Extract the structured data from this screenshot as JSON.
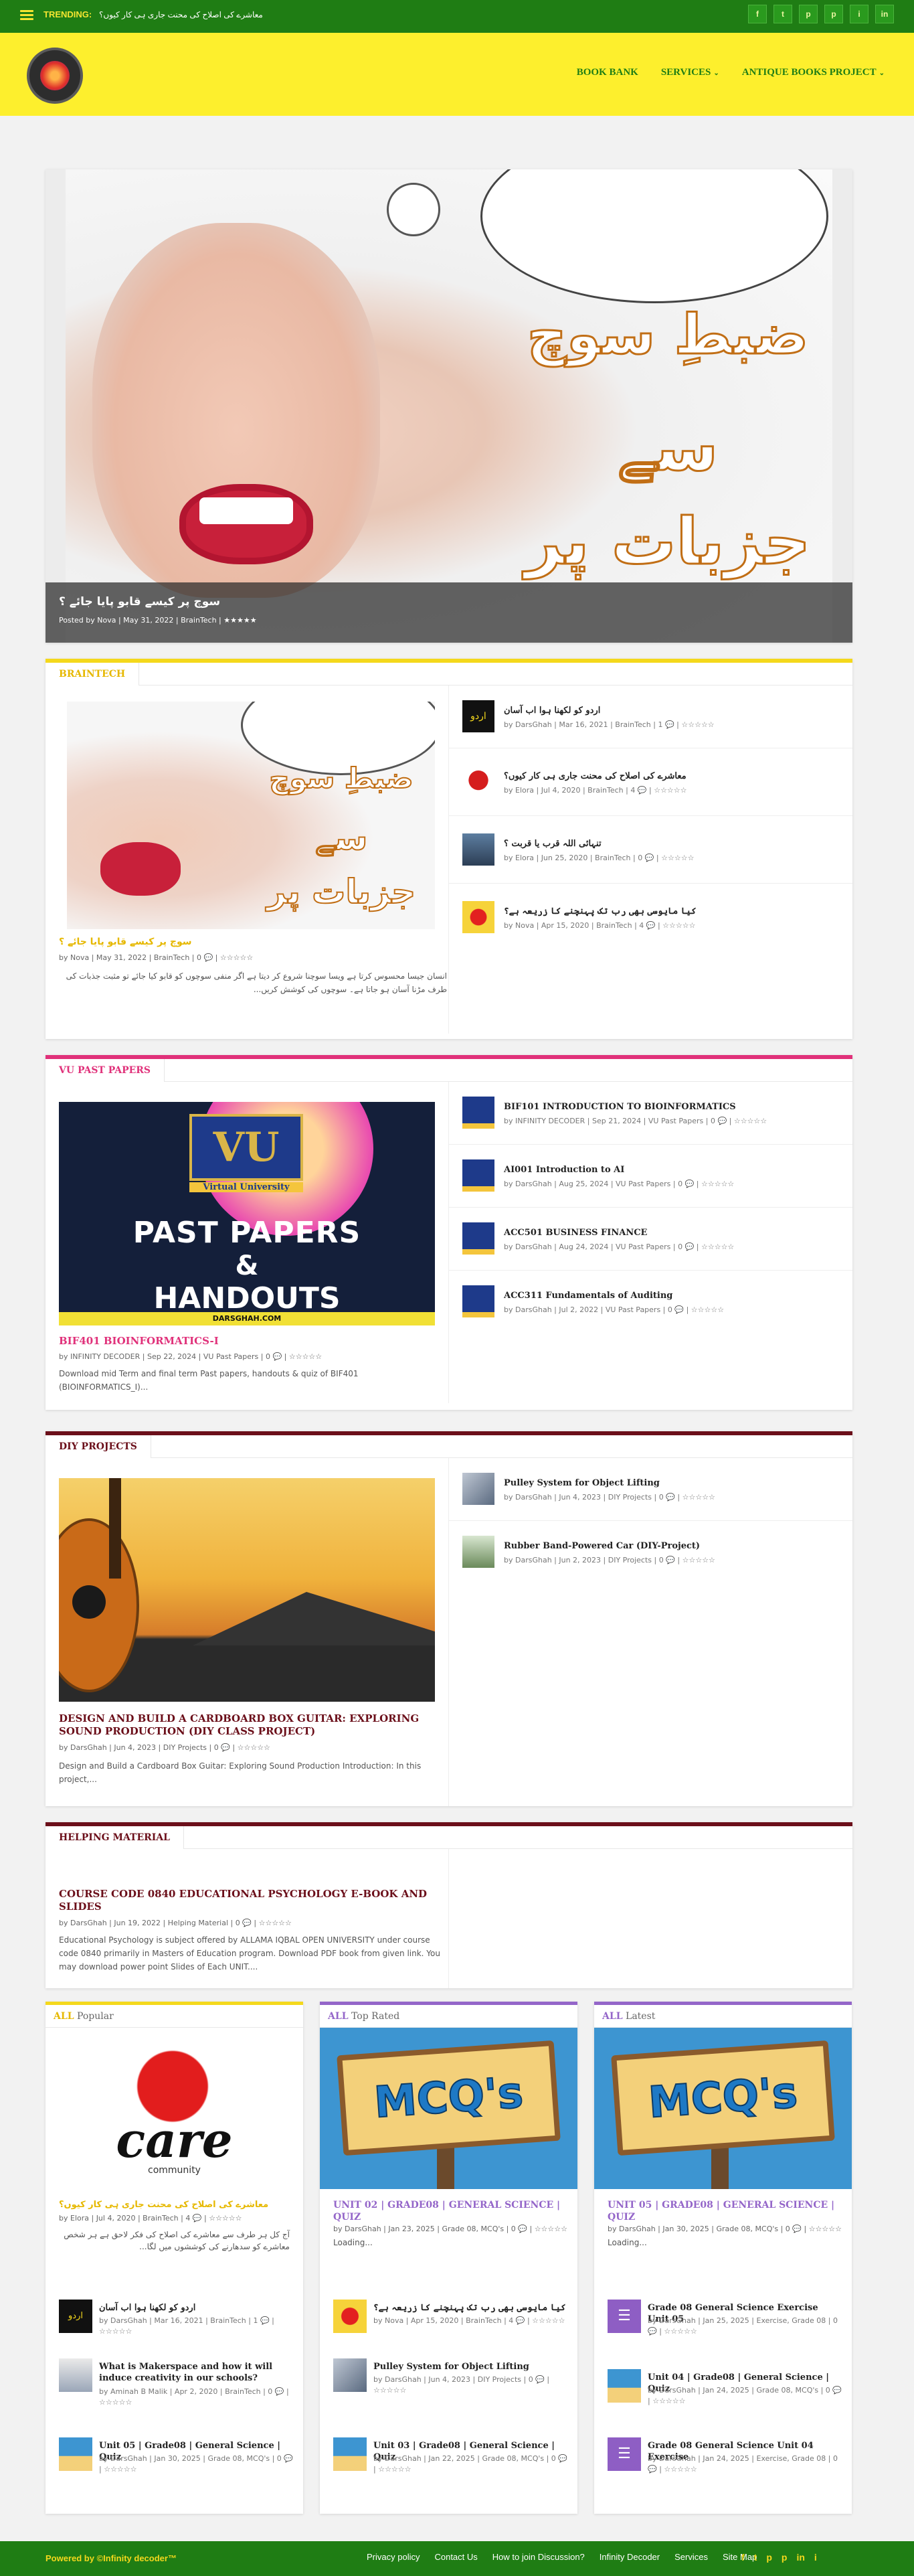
{
  "topbar": {
    "trending_label": "TRENDING:",
    "trending_text": "معاشرے کی اصلاح کی محنت جاری ہی کار کیوں؟",
    "social": [
      "f",
      "t",
      "p",
      "p",
      "i",
      "in"
    ]
  },
  "nav": {
    "items": [
      "BOOK BANK",
      "SERVICES",
      "ANTIQUE BOOKS PROJECT"
    ]
  },
  "hero": {
    "title": "سوچ پر کیسے قابو پایا جائے ؟",
    "meta": "Posted by Nova | May 31, 2022 | BrainTech | ★★★★★",
    "image_text_1": "ضبطِ سوچ",
    "image_text_2": "سے",
    "image_text_3": "جزبات پر"
  },
  "braintech": {
    "heading": "BRAINTECH",
    "main_title": "سوچ پر کیسے قابو پایا جائے ؟",
    "main_meta": "by Nova | May 31, 2022 | BrainTech | 0 💬 | ☆☆☆☆☆",
    "excerpt": "انسان جیسا محسوس کرتا ہے ویسا سوچنا شروع کر دیتا ہے اگر منفی سوچوں کو قابو کیا جائے تو مثبت جذبات کی طرف مڑنا آسان ہو جاتا ہے۔ سوچوں کی کوشش کریں...",
    "items": [
      {
        "title": "اردو کو لکھنا ہوا اب آسان",
        "meta": "by DarsGhah | Mar 16, 2021 | BrainTech | 1 💬 | ☆☆☆☆☆"
      },
      {
        "title": "معاشرے کی اصلاح کی محنت جاری ہی کار کیوں؟",
        "meta": "by Elora | Jul 4, 2020 | BrainTech | 4 💬 | ☆☆☆☆☆"
      },
      {
        "title": "تنہائی اللہ قرب یا قربت ؟",
        "meta": "by Elora | Jun 25, 2020 | BrainTech | 0 💬 | ☆☆☆☆☆"
      },
      {
        "title": "کیا مایوسی بھی رب تک پہنچنے کا زریعہ ہے؟",
        "meta": "by Nova | Apr 15, 2020 | BrainTech | 4 💬 | ☆☆☆☆☆"
      }
    ]
  },
  "vu": {
    "heading": "VU PAST PAPERS",
    "img_line1": "Virtual University",
    "img_line2": "PAST PAPERS",
    "img_line3": "&",
    "img_line4": "HANDOUTS",
    "img_footer": "DARSGHAH.COM",
    "img_logo": "VU",
    "main_title": "BIF401 BIOINFORMATICS-I",
    "main_meta": "by INFINITY DECODER | Sep 22, 2024 | VU Past Papers | 0 💬 | ☆☆☆☆☆",
    "excerpt": "Download mid Term and final term Past papers, handouts & quiz of BIF401 (BIOINFORMATICS_I)...",
    "items": [
      {
        "title": "BIF101 INTRODUCTION TO BIOINFORMATICS",
        "meta": "by INFINITY DECODER | Sep 21, 2024 | VU Past Papers | 0 💬 | ☆☆☆☆☆"
      },
      {
        "title": "AI001 Introduction to AI",
        "meta": "by DarsGhah | Aug 25, 2024 | VU Past Papers | 0 💬 | ☆☆☆☆☆"
      },
      {
        "title": "ACC501 BUSINESS FINANCE",
        "meta": "by DarsGhah | Aug 24, 2024 | VU Past Papers | 0 💬 | ☆☆☆☆☆"
      },
      {
        "title": "ACC311 Fundamentals of Auditing",
        "meta": "by DarsGhah | Jul 2, 2022 | VU Past Papers | 0 💬 | ☆☆☆☆☆"
      }
    ]
  },
  "diy": {
    "heading": "DIY PROJECTS",
    "main_title": "DESIGN AND BUILD A CARDBOARD BOX GUITAR: EXPLORING SOUND PRODUCTION (DIY CLASS PROJECT)",
    "main_meta": "by DarsGhah | Jun 4, 2023 | DIY Projects | 0 💬 | ☆☆☆☆☆",
    "excerpt": "Design and Build a Cardboard Box Guitar: Exploring Sound Production Introduction: In this project,...",
    "items": [
      {
        "title": "Pulley System for Object Lifting",
        "meta": "by DarsGhah | Jun 4, 2023 | DIY Projects | 0 💬 | ☆☆☆☆☆"
      },
      {
        "title": "Rubber Band-Powered Car (DIY-Project)",
        "meta": "by DarsGhah | Jun 2, 2023 | DIY Projects | 0 💬 | ☆☆☆☆☆"
      }
    ]
  },
  "helping": {
    "heading": "HELPING MATERIAL",
    "main_title": "COURSE CODE 0840 EDUCATIONAL PSYCHOLOGY E-BOOK AND SLIDES",
    "main_meta": "by DarsGhah | Jun 19, 2022 | Helping Material | 0 💬 | ☆☆☆☆☆",
    "excerpt": "Educational Psychology is subject offered by ALLAMA IQBAL OPEN UNIVERSITY under course code 0840 primarily in Masters of Education program. Download PDF book from given link. You may download power point Slides of Each UNIT...."
  },
  "popular": {
    "heading_prefix": "ALL",
    "heading": "Popular",
    "img_text": "care",
    "img_sub": "community",
    "main_title": "معاشرے کی اصلاح کی محنت جاری ہی کار کیوں؟",
    "main_meta": "by Elora | Jul 4, 2020 | BrainTech | 4 💬 | ☆☆☆☆☆",
    "excerpt": "آج کل ہر طرف سے معاشرے کی اصلاح کی فکر لاحق ہے ہر شخص معاشرے کو سدھارنے کی کوششوں میں لگا...",
    "items": [
      {
        "title": "اردو کو لکھنا ہوا اب آسان",
        "meta": "by DarsGhah | Mar 16, 2021 | BrainTech | 1 💬 | ☆☆☆☆☆"
      },
      {
        "title": "What is Makerspace and how it will induce creativity in our schools?",
        "meta": "by Aminah B Malik | Apr 2, 2020 | BrainTech | 0 💬 | ☆☆☆☆☆"
      },
      {
        "title": "Unit 05 | Grade08 | General Science | Quiz",
        "meta": "by DarsGhah | Jan 30, 2025 | Grade 08, MCQ's | 0 💬 | ☆☆☆☆☆"
      }
    ]
  },
  "toprated": {
    "heading_prefix": "ALL",
    "heading": "Top Rated",
    "img_text": "MCQ's",
    "main_title": "UNIT 02 | GRADE08 | GENERAL SCIENCE | QUIZ",
    "main_meta": "by DarsGhah | Jan 23, 2025 | Grade 08, MCQ's | 0 💬 | ☆☆☆☆☆",
    "excerpt": "Loading...",
    "items": [
      {
        "title": "کیا مایوسی بھی رب تک پہنچنے کا زریعہ ہے؟",
        "meta": "by Nova | Apr 15, 2020 | BrainTech | 4 💬 | ☆☆☆☆☆"
      },
      {
        "title": "Pulley System for Object Lifting",
        "meta": "by DarsGhah | Jun 4, 2023 | DIY Projects | 0 💬 | ☆☆☆☆☆"
      },
      {
        "title": "Unit 03 | Grade08 | General Science | Quiz",
        "meta": "by DarsGhah | Jan 22, 2025 | Grade 08, MCQ's | 0 💬 | ☆☆☆☆☆"
      }
    ]
  },
  "latest": {
    "heading_prefix": "ALL",
    "heading": "Latest",
    "img_text": "MCQ's",
    "main_title": "UNIT 05 | GRADE08 | GENERAL SCIENCE | QUIZ",
    "main_meta": "by DarsGhah | Jan 30, 2025 | Grade 08, MCQ's | 0 💬 | ☆☆☆☆☆",
    "excerpt": "Loading...",
    "items": [
      {
        "title": "Grade 08 General Science Exercise Unit 05",
        "meta": "by DarsGhah | Jan 25, 2025 | Exercise, Grade 08 | 0 💬 | ☆☆☆☆☆"
      },
      {
        "title": "Unit 04 | Grade08 | General Science | Quiz",
        "meta": "by DarsGhah | Jan 24, 2025 | Grade 08, MCQ's | 0 💬 | ☆☆☆☆☆"
      },
      {
        "title": "Grade 08 General Science Unit 04 Exercise",
        "meta": "by DarsGhah | Jan 24, 2025 | Exercise, Grade 08 | 0 💬 | ☆☆☆☆☆"
      }
    ]
  },
  "footer": {
    "powered": "Powered by ©Infinity decoder™",
    "links": [
      "Privacy policy",
      "Contact Us",
      "How to join Discussion?",
      "Infinity Decoder",
      "Services",
      "Site Map"
    ],
    "social": [
      "f",
      "t",
      "p",
      "p",
      "in",
      "i"
    ]
  },
  "colors": {
    "green": "#1f7d14",
    "yellow": "#fdef2d",
    "braintech": "#f4d81c",
    "vu": "#e0317a",
    "diy": "#6b0f1a",
    "helping": "#6b0f1a",
    "popular": "#f4d81c",
    "toprated": "#9466c9",
    "latest": "#9466c9"
  }
}
